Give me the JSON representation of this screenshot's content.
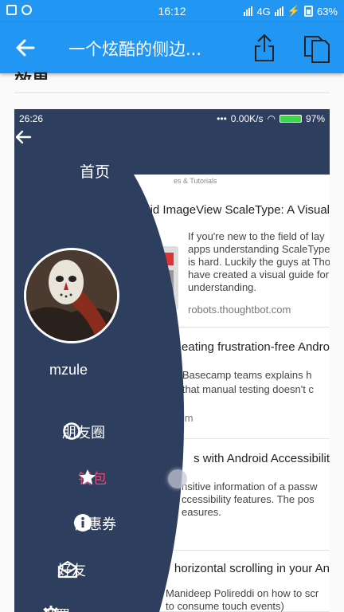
{
  "status_bar": {
    "time": "16:12",
    "network": "4G",
    "battery": "63%"
  },
  "toolbar": {
    "title": "一个炫酷的侧边...",
    "back_icon": "arrow-left-icon",
    "share_icon": "share-icon",
    "copy_icon": "copy-icon"
  },
  "article": {
    "heading_fragment": "效果"
  },
  "embedded": {
    "status_bar": {
      "time": "26:26",
      "speed": "0.00K/s",
      "battery": "97%"
    },
    "drawer": {
      "title": "首页",
      "username": "mzule",
      "items": [
        {
          "label": "朋友圈",
          "icon": "circle-icon",
          "active": false
        },
        {
          "label": "钱包",
          "icon": "star-icon",
          "active": true
        },
        {
          "label": "优惠券",
          "icon": "info-icon",
          "active": false
        },
        {
          "label": "好友",
          "icon": "mail-open-icon",
          "active": false
        },
        {
          "label": "设置",
          "icon": "gear-icon",
          "active": false
        }
      ],
      "colors": {
        "drawer_bg": "#2e3e5e",
        "active": "#e8477a"
      }
    },
    "feed": {
      "crumb": "es & Tutorials",
      "cards": [
        {
          "title": "oid ImageView ScaleType: A Visual",
          "body": [
            "If you're new to the field of lay",
            "apps understanding ScaleType",
            "is hard. Luckily the guys at Tho",
            "have created a visual guide for",
            "understanding."
          ],
          "link": "robots.thoughtbot.com"
        },
        {
          "title": "eating frustration-free Andro",
          "body": [
            "e Basecamp teams explains h",
            "o that manual testing doesn't c"
          ],
          "link": "com"
        },
        {
          "title": "s with Android Accessibilit",
          "body": [
            "nsitive information of a passw",
            "ccessibility features. The pos",
            "easures."
          ],
          "link": ""
        },
        {
          "title": "horizontal scrolling in your An",
          "body": [
            "Manideep Polireddi on how to scr",
            "to consume touch events)"
          ],
          "link": ""
        }
      ]
    }
  },
  "colors": {
    "brand": "#2196f3"
  }
}
